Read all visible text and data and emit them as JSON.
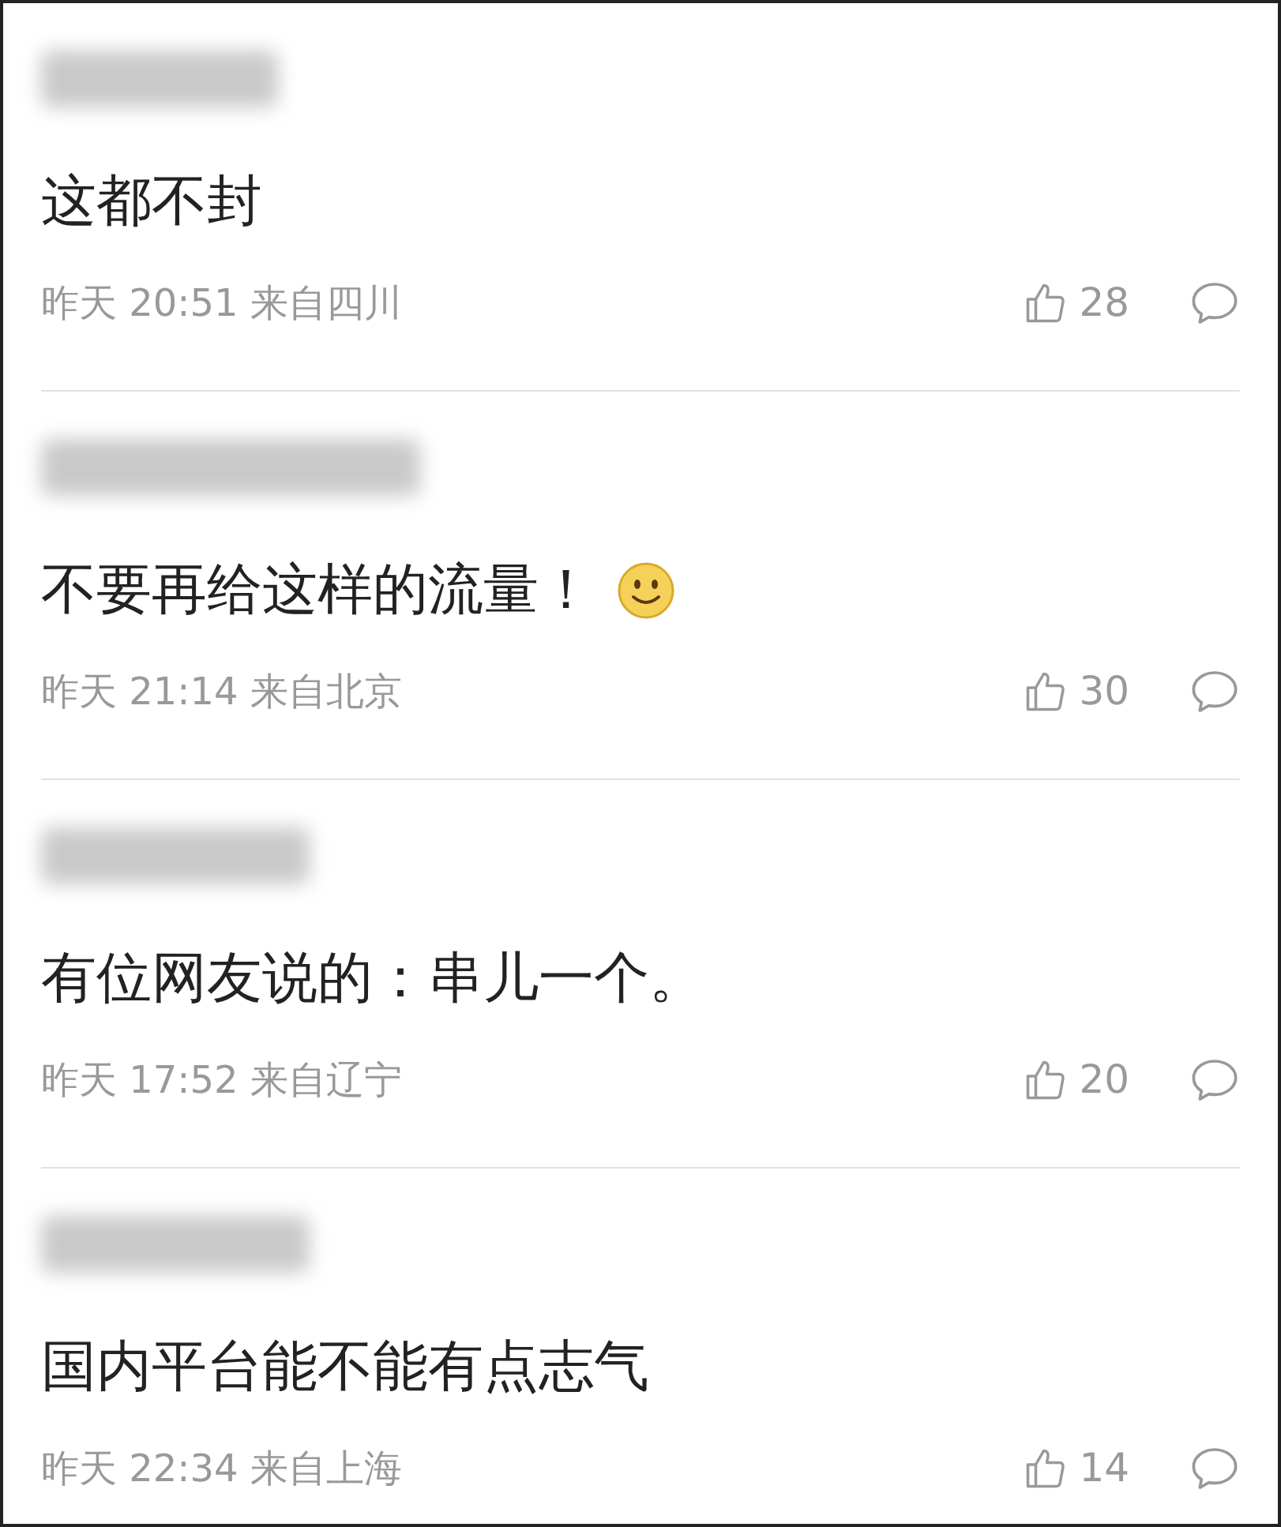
{
  "comments": [
    {
      "text": "这都不封",
      "has_emoji": false,
      "time": "昨天 20:51 来自四川",
      "likes": "28"
    },
    {
      "text": "不要再给这样的流量！",
      "has_emoji": true,
      "time": "昨天 21:14 来自北京",
      "likes": "30"
    },
    {
      "text": "有位网友说的：串儿一个。",
      "has_emoji": false,
      "time": "昨天 17:52 来自辽宁",
      "likes": "20"
    },
    {
      "text": "国内平台能不能有点志气",
      "has_emoji": false,
      "time": "昨天 22:34 来自上海",
      "likes": "14"
    }
  ]
}
